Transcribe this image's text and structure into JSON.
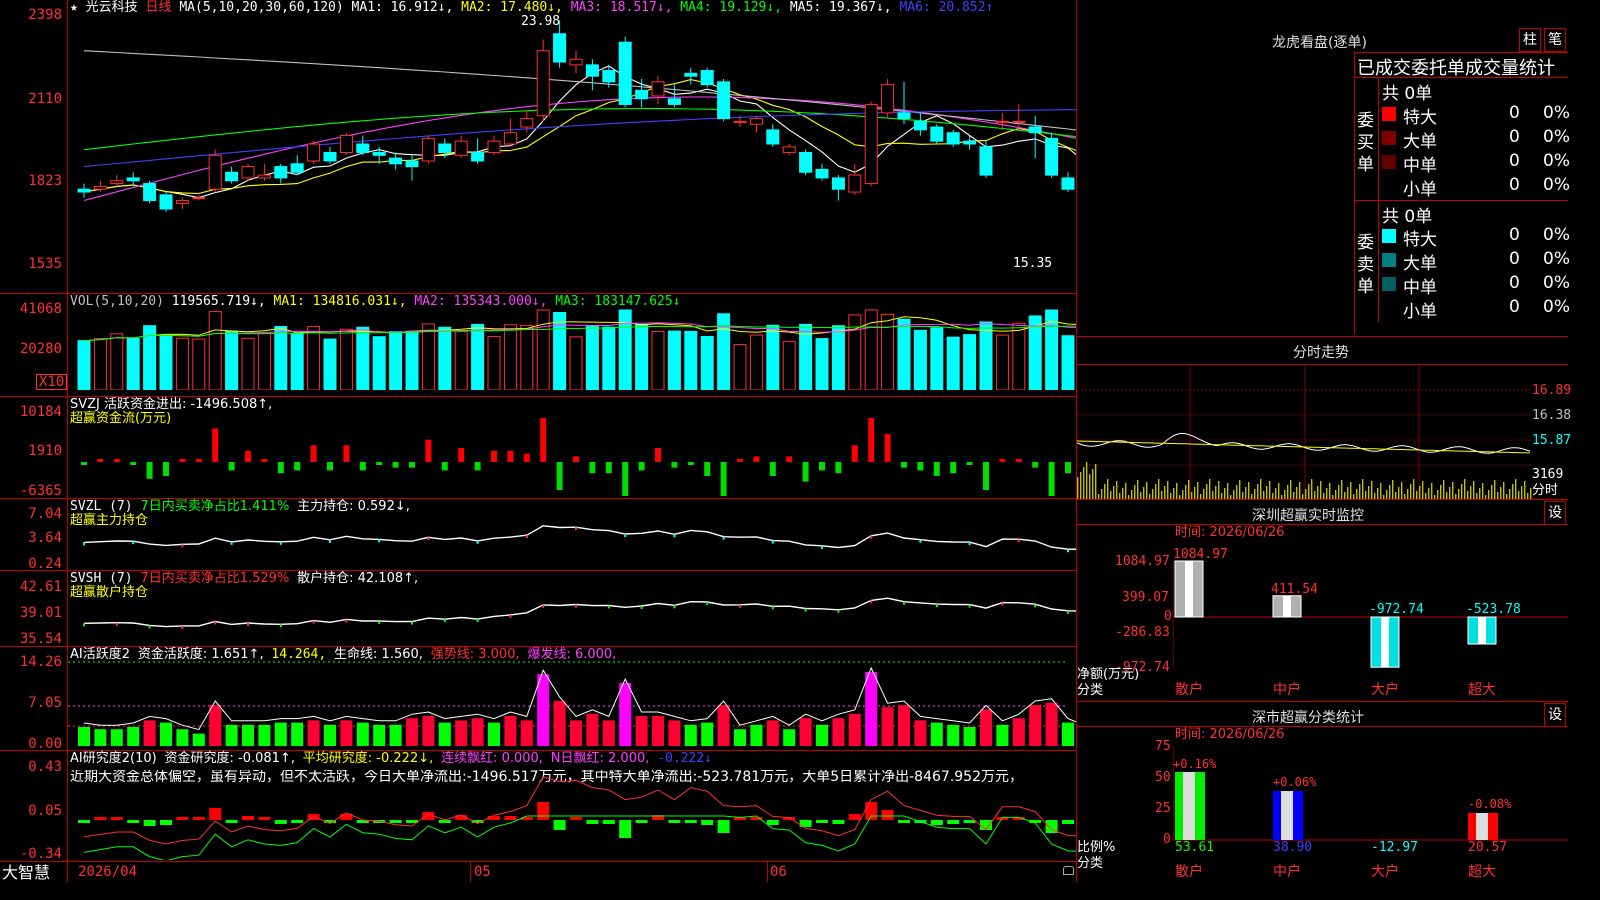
{
  "stock": {
    "star": "★",
    "name": "光云科技",
    "period": "日线"
  },
  "ma_header": {
    "label": "MA(5,10,20,30,60,120)",
    "ma1": "MA1: 16.912↓,",
    "ma2": "MA2: 17.480↓,",
    "ma3": "MA3: 18.517↓,",
    "ma4": "MA4: 19.129↓,",
    "ma5": "MA5: 19.367↓,",
    "ma6": "MA6: 20.852↑"
  },
  "price_axis": [
    "2398",
    "2110",
    "1823",
    "1535"
  ],
  "price_annot": {
    "high": "23.98",
    "low": "15.35"
  },
  "vol": {
    "axis": [
      "41068",
      "20280"
    ],
    "unit": "X10",
    "label": "VOL(5,10,20)",
    "value": "119565.719↓,",
    "ma1": "MA1: 134816.031↓,",
    "ma2": "MA2: 135343.000↓,",
    "ma3": "MA3: 183147.625↓"
  },
  "svzj": {
    "axis": [
      "10184",
      "1910",
      "-6365"
    ],
    "label": "SVZJ 活跃资金进出: -1496.508↑,",
    "sub": "超赢资金流(万元)"
  },
  "svzl": {
    "axis": [
      "7.04",
      "3.64",
      "0.24"
    ],
    "label": "SVZL (7)",
    "ratio": "7日内买卖净占比1.411%",
    "hold": "主力持仓: 0.592↓,",
    "sub": "超赢主力持仓"
  },
  "svsh": {
    "axis": [
      "42.61",
      "39.01",
      "35.54"
    ],
    "label": "SVSH (7)",
    "ratio": "7日内买卖净占比1.529%",
    "hold": "散户持仓: 42.108↑,",
    "sub": "超赢散户持仓"
  },
  "ai1": {
    "axis": [
      "14.26",
      "7.05",
      "0.00"
    ],
    "label": "AI活跃度2",
    "act": "资金活跃度: 1.651↑,",
    "v2": "14.264,",
    "life": "生命线: 1.560,",
    "strong": "强势线: 3.000,",
    "burst": "爆发线: 6.000,"
  },
  "ai2": {
    "axis": [
      "0.43",
      "0.05",
      "-0.34"
    ],
    "label": "AI研究度2(10)",
    "fund": "资金研究度: -0.081↑,",
    "avg": "平均研究度: -0.222↓,",
    "cont": "连续飘红: 0.000,",
    "nday": "N日飘红: 2.000,",
    "last": "-0.222↓",
    "comment": "近期大资金总体偏空，虽有异动，但不太活跃，今日大单净流出:-1496.517万元，其中特大单净流出:-523.781万元，大单5日累计净出-8467.952万元，"
  },
  "x_axis": {
    "brand": "大智慧",
    "d1": "2026/04",
    "d2": "05",
    "d3": "06"
  },
  "longhu": {
    "title": "龙虎看盘(逐单)",
    "btn1": "柱",
    "btn2": "笔",
    "header": "已成交委托单成交量统计",
    "buy_label": "委买单",
    "sell_label": "委卖单",
    "buy_total": "共 0单",
    "sell_total": "共 0单",
    "buy_rows": [
      {
        "name": "特大",
        "count": "0",
        "pct": "0%",
        "color": "#ff0000"
      },
      {
        "name": "大单",
        "count": "0",
        "pct": "0%",
        "color": "#800000"
      },
      {
        "name": "中单",
        "count": "0",
        "pct": "0%",
        "color": "#600000"
      },
      {
        "name": "小单",
        "count": "0",
        "pct": "0%",
        "color": ""
      }
    ],
    "sell_rows": [
      {
        "name": "特大",
        "count": "0",
        "pct": "0%",
        "color": "#00ffff"
      },
      {
        "name": "大单",
        "count": "0",
        "pct": "0%",
        "color": "#008080"
      },
      {
        "name": "中单",
        "count": "0",
        "pct": "0%",
        "color": "#006060"
      },
      {
        "name": "小单",
        "count": "0",
        "pct": "0%",
        "color": ""
      }
    ]
  },
  "intraday": {
    "title": "分时走势",
    "axis": [
      "16.89",
      "16.38",
      "15.87"
    ],
    "vol_axis": "3169",
    "vol_label": "分时"
  },
  "sz_monitor": {
    "title": "深圳超赢实时监控",
    "btn": "设",
    "time": "时间: 2026/06/26",
    "axis": [
      "1084.97",
      "399.07",
      "0",
      "-286.83",
      "-972.74"
    ],
    "ylabel": "净额(万元)",
    "xlabel": "分类",
    "categories": [
      "散户",
      "中户",
      "大户",
      "超大"
    ],
    "values": [
      "1084.97",
      "411.54",
      "-972.74",
      "-523.78"
    ]
  },
  "sz_class": {
    "title": "深市超赢分类统计",
    "btn": "设",
    "time": "时间: 2026/06/26",
    "axis": [
      "75",
      "50",
      "25",
      "0"
    ],
    "ylabel": "比例%",
    "xlabel": "分类",
    "categories": [
      "散户",
      "中户",
      "大户",
      "超大"
    ],
    "bar_labels": [
      "+0.16%",
      "+0.06%",
      "-0.08%"
    ],
    "bottom_values": [
      "53.61",
      "38.90",
      "-12.97",
      "20.57"
    ]
  },
  "chart_data": [
    {
      "type": "candlestick",
      "title": "光云科技 日线",
      "ylim": [
        15.35,
        23.98
      ],
      "candles": [
        [
          18.0,
          17.9,
          18.2,
          17.7
        ],
        [
          18.0,
          18.1,
          18.3,
          17.9
        ],
        [
          18.2,
          18.3,
          18.5,
          18.1
        ],
        [
          18.4,
          18.3,
          18.6,
          18.1
        ],
        [
          18.2,
          17.6,
          18.3,
          17.5
        ],
        [
          17.8,
          17.3,
          17.9,
          17.2
        ],
        [
          17.5,
          17.6,
          17.7,
          17.3
        ],
        [
          17.7,
          17.7,
          17.8,
          17.6
        ],
        [
          18.0,
          19.2,
          19.4,
          17.9
        ],
        [
          18.6,
          18.3,
          18.8,
          18.2
        ],
        [
          18.4,
          18.8,
          18.9,
          18.3
        ],
        [
          18.4,
          18.5,
          18.9,
          18.3
        ],
        [
          18.8,
          18.4,
          18.9,
          18.2
        ],
        [
          18.9,
          18.6,
          19.2,
          18.5
        ],
        [
          19.0,
          19.6,
          19.7,
          18.9
        ],
        [
          19.3,
          19.0,
          19.5,
          18.9
        ],
        [
          19.3,
          19.9,
          20.0,
          19.2
        ],
        [
          19.6,
          19.3,
          19.9,
          19.2
        ],
        [
          19.3,
          19.2,
          19.5,
          18.9
        ],
        [
          19.1,
          18.9,
          19.3,
          18.7
        ],
        [
          19.0,
          18.8,
          19.2,
          18.3
        ],
        [
          19.0,
          19.8,
          19.9,
          18.9
        ],
        [
          19.6,
          19.3,
          19.8,
          19.1
        ],
        [
          19.2,
          19.7,
          19.9,
          19.1
        ],
        [
          19.3,
          19.0,
          19.8,
          18.9
        ],
        [
          19.3,
          19.7,
          19.9,
          19.2
        ],
        [
          19.6,
          20.0,
          20.5,
          19.5
        ],
        [
          20.2,
          20.5,
          20.8,
          20.0
        ],
        [
          20.6,
          22.9,
          23.3,
          20.4
        ],
        [
          23.5,
          22.5,
          23.98,
          22.3
        ],
        [
          22.4,
          22.6,
          22.9,
          22.1
        ],
        [
          22.4,
          22.0,
          22.6,
          21.5
        ],
        [
          22.2,
          21.8,
          22.4,
          21.6
        ],
        [
          23.2,
          21.0,
          23.4,
          20.9
        ],
        [
          21.5,
          21.2,
          21.9,
          20.9
        ],
        [
          21.3,
          21.8,
          22.0,
          21.0
        ],
        [
          21.2,
          21.0,
          21.7,
          20.9
        ],
        [
          22.1,
          22.0,
          22.3,
          21.7
        ],
        [
          22.2,
          21.7,
          22.3,
          21.6
        ],
        [
          21.8,
          20.5,
          21.9,
          20.4
        ],
        [
          20.4,
          20.4,
          20.6,
          20.2
        ],
        [
          20.3,
          20.5,
          20.6,
          20.0
        ],
        [
          20.1,
          19.6,
          20.3,
          19.5
        ],
        [
          19.3,
          19.5,
          19.6,
          19.2
        ],
        [
          19.3,
          18.6,
          19.4,
          18.5
        ],
        [
          18.7,
          18.4,
          18.9,
          18.3
        ],
        [
          18.4,
          18.0,
          18.5,
          17.6
        ],
        [
          17.9,
          18.5,
          18.9,
          17.8
        ],
        [
          18.2,
          21.0,
          21.1,
          18.1
        ],
        [
          20.7,
          21.7,
          21.9,
          20.5
        ],
        [
          20.7,
          20.5,
          21.8,
          20.3
        ],
        [
          20.4,
          20.1,
          20.7,
          19.9
        ],
        [
          20.2,
          19.7,
          20.3,
          19.6
        ],
        [
          20.0,
          19.6,
          20.1,
          19.5
        ],
        [
          19.7,
          19.6,
          19.9,
          19.4
        ],
        [
          19.5,
          18.5,
          19.7,
          18.4
        ],
        [
          20.4,
          20.4,
          20.7,
          20.1
        ],
        [
          20.4,
          20.4,
          21.0,
          20.1
        ],
        [
          20.2,
          20.0,
          20.6,
          19.1
        ],
        [
          19.8,
          18.5,
          20.0,
          18.4
        ],
        [
          18.4,
          18.0,
          18.6,
          17.9
        ],
        [
          18.1,
          18.0,
          18.3,
          17.9
        ],
        [
          17.9,
          18.2,
          18.3,
          17.9
        ],
        [
          18.1,
          17.9,
          18.3,
          17.8
        ],
        [
          17.9,
          17.8,
          18.0,
          17.7
        ],
        [
          18.0,
          18.1,
          18.1,
          17.6
        ],
        [
          18.0,
          18.0,
          18.2,
          17.3
        ],
        [
          17.9,
          17.5,
          18.0,
          17.4
        ],
        [
          17.4,
          17.2,
          17.5,
          17.0
        ],
        [
          17.1,
          16.7,
          17.2,
          16.6
        ],
        [
          16.4,
          15.9,
          16.6,
          15.7
        ],
        [
          15.9,
          15.35,
          16.0,
          15.35
        ]
      ]
    }
  ]
}
